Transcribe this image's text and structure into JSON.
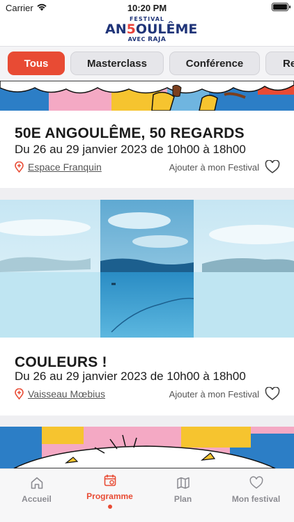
{
  "status_bar": {
    "carrier": "Carrier",
    "time": "10:20 PM"
  },
  "header": {
    "logo_top": "FESTIVAL",
    "logo_main_a": "AN",
    "logo_main_five": "5",
    "logo_main_b": "OULÊME",
    "logo_bottom_avec": "AVEC",
    "logo_bottom_raja": "RAJA"
  },
  "tabs": [
    {
      "label": "Tous",
      "active": true
    },
    {
      "label": "Masterclass",
      "active": false
    },
    {
      "label": "Conférence",
      "active": false
    },
    {
      "label": "Re",
      "active": false
    }
  ],
  "events": [
    {
      "title": "50E ANGOULÊME, 50 REGARDS",
      "dates": "Du 26 au 29 janvier 2023 de 10h00 à 18h00",
      "place": "Espace Franquin",
      "add_label": "Ajouter à mon Festival"
    },
    {
      "title": "COULEURS !",
      "dates": "Du 26 au 29 janvier 2023 de 10h00 à 18h00",
      "place": "Vaisseau Mœbius",
      "add_label": "Ajouter à mon Festival"
    }
  ],
  "nav": [
    {
      "label": "Accueil",
      "icon": "home-icon",
      "active": false
    },
    {
      "label": "Programme",
      "icon": "calendar-icon",
      "active": true
    },
    {
      "label": "Plan",
      "icon": "map-icon",
      "active": false
    },
    {
      "label": "Mon festival",
      "icon": "heart-icon",
      "active": false
    }
  ],
  "colors": {
    "accent": "#e84b34",
    "brand_blue": "#1f3478"
  }
}
